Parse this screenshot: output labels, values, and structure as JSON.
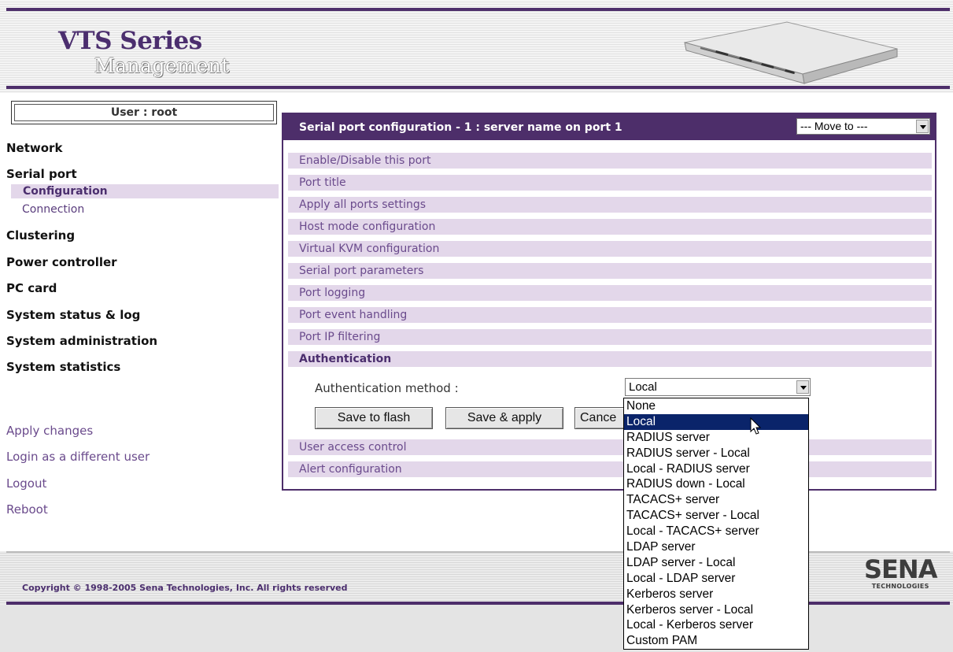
{
  "header": {
    "title": "VTS Series",
    "subtitle": "Management"
  },
  "sidebar": {
    "user_label": "User : root",
    "nav": {
      "network": "Network",
      "serial_port": "Serial port",
      "configuration": "Configuration",
      "connection": "Connection",
      "clustering": "Clustering",
      "power_controller": "Power controller",
      "pc_card": "PC card",
      "system_status": "System status & log",
      "system_admin": "System administration",
      "system_statistics": "System statistics"
    },
    "links": {
      "apply_changes": "Apply changes",
      "login_different": "Login as a different user",
      "logout": "Logout",
      "reboot": "Reboot"
    }
  },
  "panel": {
    "title": "Serial port configuration - 1 : server name on port 1",
    "move_to": "--- Move to ---",
    "rows": [
      "Enable/Disable this port",
      "Port title",
      "Apply all ports settings",
      "Host mode configuration",
      "Virtual KVM configuration",
      "Serial port parameters",
      "Port logging",
      "Port event handling",
      "Port IP filtering",
      "Authentication"
    ],
    "auth_label": "Authentication method :",
    "auth_value": "Local",
    "buttons": {
      "save_flash": "Save to flash",
      "save_apply": "Save & apply",
      "cancel": "Cance"
    },
    "bottom_rows": [
      "User access control",
      "Alert configuration"
    ]
  },
  "auth_options": [
    "None",
    "Local",
    "RADIUS server",
    "RADIUS server - Local",
    "Local - RADIUS server",
    "RADIUS down - Local",
    "TACACS+ server",
    "TACACS+ server - Local",
    "Local - TACACS+ server",
    "LDAP server",
    "LDAP server - Local",
    "Local - LDAP server",
    "Kerberos server",
    "Kerberos server - Local",
    "Local - Kerberos server",
    "Custom PAM"
  ],
  "auth_selected": "Local",
  "footer": {
    "copyright": "Copyright © 1998-2005 Sena Technologies, Inc. All rights reserved",
    "logo_big": "SENA",
    "logo_small": "TECHNOLOGIES"
  },
  "colors": {
    "brand_purple": "#4d2e6a",
    "row_bg": "#e3d7ea",
    "link_purple": "#6a4a8c",
    "selection_blue": "#0a246a"
  }
}
